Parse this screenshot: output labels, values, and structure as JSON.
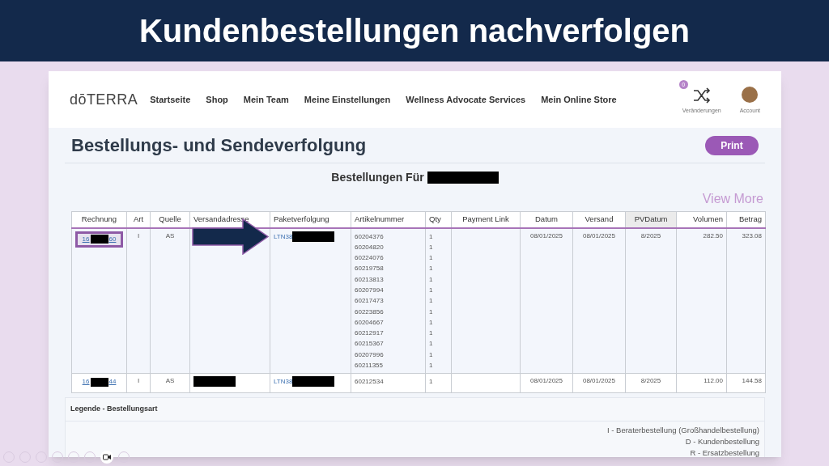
{
  "slide_title": "Kundenbestellungen nachverfolgen",
  "nav": {
    "logo": "dōTERRA",
    "items": [
      "Startseite",
      "Shop",
      "Mein Team",
      "Meine Einstellungen",
      "Wellness Advocate Services",
      "Mein Online Store"
    ],
    "changes": {
      "badge": "0",
      "label": "Veränderungen"
    },
    "account": {
      "label": "Account"
    }
  },
  "page_title": "Bestellungs- und Sendeverfolgung",
  "print_button": "Print",
  "orders_for": "Bestellungen Für",
  "view_more": "View More",
  "table": {
    "columns": [
      "Rechnung",
      "Art",
      "Quelle",
      "Versandadresse",
      "Paketverfolgung",
      "Artikelnummer",
      "Qty",
      "Payment Link",
      "Datum",
      "Versand",
      "PVDatum",
      "Volumen",
      "Betrag"
    ],
    "rows": [
      {
        "invoice_start": "16",
        "invoice_end": "60",
        "highlighted": true,
        "art": "I",
        "quelle": "AS",
        "address_redacted": false,
        "tracking": "LTN38",
        "items": [
          {
            "article": "60204376",
            "qty": "1"
          },
          {
            "article": "60204820",
            "qty": "1"
          },
          {
            "article": "60224076",
            "qty": "1"
          },
          {
            "article": "60219758",
            "qty": "1"
          },
          {
            "article": "60213813",
            "qty": "1"
          },
          {
            "article": "60207994",
            "qty": "1"
          },
          {
            "article": "60217473",
            "qty": "1"
          },
          {
            "article": "60223856",
            "qty": "1"
          },
          {
            "article": "60204667",
            "qty": "1"
          },
          {
            "article": "60212917",
            "qty": "1"
          },
          {
            "article": "60215367",
            "qty": "1"
          },
          {
            "article": "60207996",
            "qty": "1"
          },
          {
            "article": "60211355",
            "qty": "1"
          }
        ],
        "datum": "08/01/2025",
        "versand": "08/01/2025",
        "pvdatum": "8/2025",
        "volumen": "282.50",
        "betrag": "323.08"
      },
      {
        "invoice_start": "16",
        "invoice_end": "44",
        "highlighted": false,
        "art": "I",
        "quelle": "AS",
        "address_redacted": true,
        "tracking": "LTN38",
        "items": [
          {
            "article": "60212534",
            "qty": "1"
          }
        ],
        "datum": "08/01/2025",
        "versand": "08/01/2025",
        "pvdatum": "8/2025",
        "volumen": "112.00",
        "betrag": "144.58"
      }
    ]
  },
  "legend": {
    "title": "Legende - Bestellungsart",
    "entries": [
      "I - Beraterbestellung (Großhandelbestellung)",
      "D - Kundenbestellung",
      "R - Ersatzbestellung"
    ]
  }
}
